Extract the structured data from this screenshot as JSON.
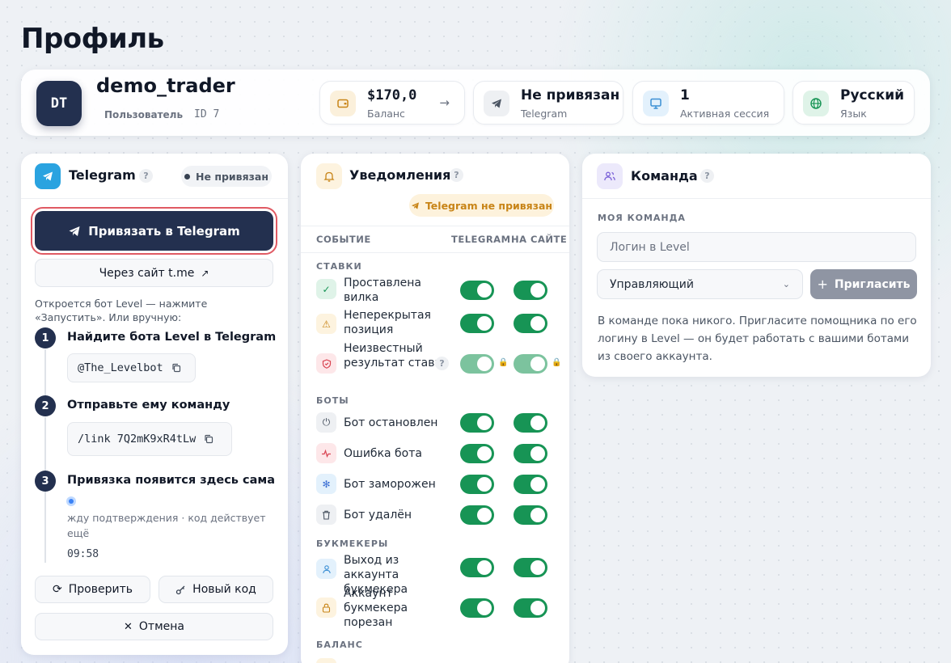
{
  "page": {
    "title": "Профиль"
  },
  "profile": {
    "initials": "DT",
    "username": "demo_trader",
    "role": "Пользователь",
    "user_id": "ID 7"
  },
  "stats": [
    {
      "value": "$170,0",
      "label": "Баланс",
      "icon": "wallet-icon",
      "arrow": "→"
    },
    {
      "value": "Не привязан",
      "label": "Telegram",
      "icon": "telegram-icon"
    },
    {
      "value": "1",
      "label": "Активная сессия",
      "icon": "monitor-icon"
    },
    {
      "value": "Русский",
      "label": "Язык",
      "icon": "globe-icon"
    }
  ],
  "telegram_card": {
    "title": "Telegram",
    "status": "Не привязан",
    "primary_button": "Привязать в Telegram",
    "site_button": "Через сайт t.me",
    "hint": "Откроется бот Level — нажмите «Запустить». Или вручную:",
    "steps": [
      {
        "num": "1",
        "title": "Найдите бота Level в Telegram",
        "code": "@The_Levelbot"
      },
      {
        "num": "2",
        "title": "Отправьте ему команду",
        "code": "/link 7Q2mK9xR4tLw"
      },
      {
        "num": "3",
        "title": "Привязка появится здесь сама"
      }
    ],
    "waiting_text": "жду подтверждения · код действует ещё",
    "timer": "09:58",
    "check_button": "Проверить",
    "new_code_button": "Новый код",
    "cancel_button": "Отмена"
  },
  "notifications": {
    "title": "Уведомления",
    "warning_badge": "Telegram не привязан",
    "col_event": "СОБЫТИЕ",
    "col_telegram": "TELEGRAM",
    "col_site": "НА САЙТЕ",
    "sections": [
      {
        "label": "СТАВКИ",
        "items": [
          {
            "label": "Проставлена вилка",
            "telegram": true,
            "site": true
          },
          {
            "label": "Неперекрытая позиция",
            "telegram": true,
            "site": true
          },
          {
            "label": "Неизвестный результат ставки",
            "telegram": true,
            "site": true,
            "locked": true
          }
        ]
      },
      {
        "label": "БОТЫ",
        "items": [
          {
            "label": "Бот остановлен",
            "telegram": true,
            "site": true
          },
          {
            "label": "Ошибка бота",
            "telegram": true,
            "site": true
          },
          {
            "label": "Бот заморожен",
            "telegram": true,
            "site": true
          },
          {
            "label": "Бот удалён",
            "telegram": true,
            "site": true
          }
        ]
      },
      {
        "label": "БУКМЕКЕРЫ",
        "items": [
          {
            "label": "Выход из аккаунта букмекера",
            "telegram": true,
            "site": true
          },
          {
            "label": "Аккаунт букмекера порезан",
            "telegram": true,
            "site": true
          }
        ]
      },
      {
        "label": "БАЛАНС",
        "items": []
      }
    ]
  },
  "team": {
    "title": "Команда",
    "section_label": "МОЯ КОМАНДА",
    "login_placeholder": "Логин в Level",
    "role_select": "Управляющий",
    "invite_button": "Пригласить",
    "empty_text": "В команде пока никого. Пригласите помощника по его логину в Level — он будет работать с вашими ботами из своего аккаунта."
  },
  "colors": {
    "primary": "#23304f",
    "toggle_on": "#179455",
    "warning": "#c88417",
    "highlight": "#e05a63"
  }
}
